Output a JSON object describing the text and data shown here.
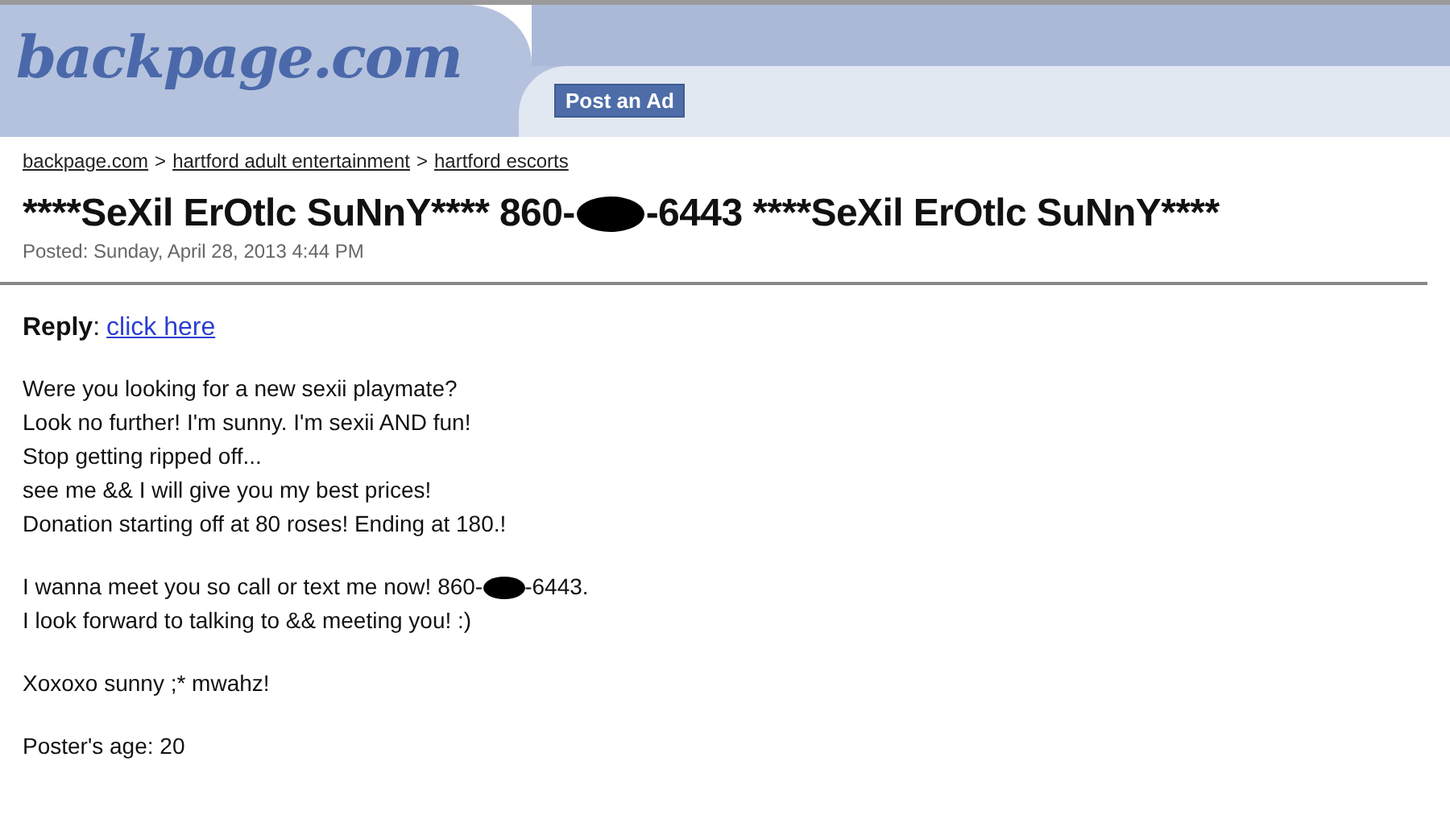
{
  "header": {
    "logo": "backpage.com",
    "post_button": "Post an Ad"
  },
  "breadcrumbs": {
    "separator": ">",
    "items": [
      "backpage.com",
      "hartford adult entertainment",
      "hartford escorts"
    ]
  },
  "title": {
    "before": "****SeXil ErOtlc SuNnY**** 860-",
    "after": "-6443 ****SeXil ErOtlc SuNnY****"
  },
  "posted": "Posted: Sunday, April 28, 2013 4:44 PM",
  "reply": {
    "label": "**Reply**:",
    "link": "click here"
  },
  "body": [
    [
      {
        "kind": "plain",
        "text": "Were you looking for a new sexii playmate?"
      },
      {
        "kind": "plain",
        "text": "Look no further! I'm sunny. I'm sexii AND fun!"
      },
      {
        "kind": "plain",
        "text": "Stop getting ripped off..."
      },
      {
        "kind": "plain",
        "text": "see me && I will give you my best prices!"
      },
      {
        "kind": "plain",
        "text": "Donation starting off at 80 roses! Ending at 180.!"
      }
    ],
    [
      {
        "kind": "redacted",
        "before": "I wanna meet you so call or text me now! 860-",
        "after": "-6443."
      },
      {
        "kind": "plain",
        "text": "I look forward to talking to && meeting you! :)"
      }
    ],
    [
      {
        "kind": "plain",
        "text": "Xoxoxo sunny ;* mwahz!"
      }
    ],
    [
      {
        "kind": "plain",
        "text": "Poster's age: 20"
      }
    ]
  ]
}
